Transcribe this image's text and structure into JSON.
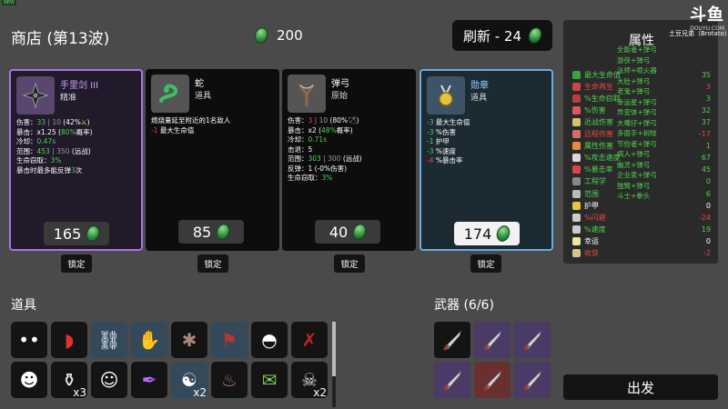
{
  "corner_tag": "NEW",
  "shop": {
    "title": "商店 (第13波)",
    "money": "200",
    "refresh_label": "刷新 - 24"
  },
  "cards": [
    {
      "name": "手里剑 III",
      "sub": "精准",
      "stats": [
        [
          {
            "t": "伤害：",
            "c": ""
          },
          {
            "t": "33",
            "c": "g"
          },
          {
            "t": " | 10 ",
            "c": "gy"
          },
          {
            "t": "(42%",
            "c": ""
          },
          {
            "t": "⚔",
            "c": "y"
          },
          {
            "t": ")",
            "c": ""
          }
        ],
        [
          {
            "t": "暴击：",
            "c": ""
          },
          {
            "t": "x1.25",
            "c": ""
          },
          {
            "t": " (",
            "c": ""
          },
          {
            "t": "80%",
            "c": "g"
          },
          {
            "t": "概率)",
            "c": ""
          }
        ],
        [
          {
            "t": "冷却：",
            "c": ""
          },
          {
            "t": "0.47s",
            "c": "g"
          }
        ],
        [
          {
            "t": "范围：",
            "c": ""
          },
          {
            "t": "453",
            "c": "g"
          },
          {
            "t": " | 350 ",
            "c": "gy"
          },
          {
            "t": "(远战)",
            "c": ""
          }
        ],
        [
          {
            "t": "生命窃取：",
            "c": ""
          },
          {
            "t": "3%",
            "c": "g"
          }
        ],
        [
          {
            "t": "暴击时最多能反弹",
            "c": ""
          },
          {
            "t": "3",
            "c": "g"
          },
          {
            "t": "次",
            "c": ""
          }
        ]
      ],
      "price": "165",
      "lock": "锁定"
    },
    {
      "name": "蛇",
      "sub": "道具",
      "stats": [
        [
          {
            "t": "燃烧量延至附近的1名敌人",
            "c": ""
          }
        ],
        [
          {
            "t": "-1",
            "c": "r"
          },
          {
            "t": " 最大生命值",
            "c": ""
          }
        ]
      ],
      "price": "85",
      "lock": "锁定"
    },
    {
      "name": "弹弓",
      "sub": "原始",
      "stats": [
        [
          {
            "t": "伤害：",
            "c": ""
          },
          {
            "t": "3",
            "c": "r"
          },
          {
            "t": " | 10 ",
            "c": "gy"
          },
          {
            "t": "(80%",
            "c": ""
          },
          {
            "t": "🏹",
            "c": "y"
          },
          {
            "t": ")",
            "c": ""
          }
        ],
        [
          {
            "t": "暴击：",
            "c": ""
          },
          {
            "t": "x2",
            "c": ""
          },
          {
            "t": " (",
            "c": ""
          },
          {
            "t": "48%",
            "c": "g"
          },
          {
            "t": "概率)",
            "c": ""
          }
        ],
        [
          {
            "t": "冷却：",
            "c": ""
          },
          {
            "t": "0.71s",
            "c": "g"
          }
        ],
        [
          {
            "t": "击退：",
            "c": ""
          },
          {
            "t": "5",
            "c": ""
          }
        ],
        [
          {
            "t": "范围：",
            "c": ""
          },
          {
            "t": "303",
            "c": "g"
          },
          {
            "t": " | 300 ",
            "c": "gy"
          },
          {
            "t": "(远战)",
            "c": ""
          }
        ],
        [
          {
            "t": "反弹：",
            "c": ""
          },
          {
            "t": "1 (-0%伤害)",
            "c": ""
          }
        ],
        [
          {
            "t": "生命窃取：",
            "c": ""
          },
          {
            "t": "3%",
            "c": "g"
          }
        ]
      ],
      "price": "40",
      "lock": "锁定"
    },
    {
      "name": "勋章",
      "sub": "道具",
      "stats": [
        [
          {
            "t": "-3",
            "c": "g"
          },
          {
            "t": " 最大生命值",
            "c": ""
          }
        ],
        [
          {
            "t": "-3",
            "c": "g"
          },
          {
            "t": " %伤害",
            "c": ""
          }
        ],
        [
          {
            "t": "-1",
            "c": "g"
          },
          {
            "t": " 护甲",
            "c": ""
          }
        ],
        [
          {
            "t": "-3",
            "c": "g"
          },
          {
            "t": " %速度",
            "c": ""
          }
        ],
        [
          {
            "t": "-4",
            "c": "r"
          },
          {
            "t": " %暴击率",
            "c": ""
          }
        ]
      ],
      "price": "174",
      "lock": "锁定"
    }
  ],
  "attributes": {
    "title": "属性",
    "rows": [
      {
        "label": "最大生命值",
        "value": "35",
        "color": "#4fd14f",
        "icon": "heart-icon",
        "ic": "#3ca43c"
      },
      {
        "label": "生命再生",
        "value": "3",
        "color": "#e84545",
        "icon": "regen-icon",
        "ic": "#d04545"
      },
      {
        "label": "%生命窃取",
        "value": "3",
        "color": "#4fd14f",
        "icon": "drop-icon",
        "ic": "#c03c3c"
      },
      {
        "label": "%伤害",
        "value": "32",
        "color": "#4fd14f",
        "icon": "damage-icon",
        "ic": "#d85a5a"
      },
      {
        "label": "近战伤害",
        "value": "37",
        "color": "#4fd14f",
        "icon": "sword-icon",
        "ic": "#d8c46a"
      },
      {
        "label": "远程伤害",
        "value": "-17",
        "color": "#e84545",
        "icon": "bow-icon",
        "ic": "#d86a6a"
      },
      {
        "label": "属性伤害",
        "value": "1",
        "color": "#4fd14f",
        "icon": "fire-icon",
        "ic": "#e88a3a"
      },
      {
        "label": "%攻击速度",
        "value": "67",
        "color": "#4fd14f",
        "icon": "hourglass-icon",
        "ic": "#d8d8d8"
      },
      {
        "label": "%暴击率",
        "value": "45",
        "color": "#4fd14f",
        "icon": "crit-icon",
        "ic": "#d84545"
      },
      {
        "label": "工程学",
        "value": "0",
        "color": "#4fd14f",
        "icon": "wrench-icon",
        "ic": "#888"
      },
      {
        "label": "范围",
        "value": "6",
        "color": "#4fd14f",
        "icon": "range-icon",
        "ic": "#bbb"
      },
      {
        "label": "护甲",
        "value": "0",
        "color": "#ffffff",
        "icon": "shield-icon",
        "ic": "#e8c43a"
      },
      {
        "label": "%闪避",
        "value": "-24",
        "color": "#e84545",
        "icon": "dodge-icon",
        "ic": "#ccc"
      },
      {
        "label": "%速度",
        "value": "19",
        "color": "#4fd14f",
        "icon": "speed-icon",
        "ic": "#ccc"
      },
      {
        "label": "幸运",
        "value": "0",
        "color": "#ffffff",
        "icon": "luck-icon",
        "ic": "#e8e8a0"
      },
      {
        "label": "收获",
        "value": "-2",
        "color": "#e84545",
        "icon": "harvest-icon",
        "ic": "#d8c48a"
      }
    ],
    "overlay_lines": [
      "全能者+弹弓",
      "游侠+弹弓",
      "法师+喷火器",
      "大肚+弹弓",
      "老鬼+弹弓",
      "幸运星+弹弓",
      "异变体+弹弓",
      "大嘴仔+弹弓",
      "多面手+树枝",
      "节俭者+弹弓",
      "病人+弹弓",
      "幽灵+弹弓",
      "企业家+弹弓",
      "独臂+弹弓",
      "斗士+拳头"
    ]
  },
  "logo": {
    "big": "斗鱼",
    "small": "DOUYU.COM",
    "tag": "土豆兄弟（Brotato）"
  },
  "items": {
    "title": "道具",
    "list": [
      {
        "name": "eyes-item-icon",
        "count": "",
        "bg": ""
      },
      {
        "name": "red-blade-item-icon",
        "count": "",
        "bg": ""
      },
      {
        "name": "chain-item-icon",
        "count": "",
        "bg": "blue"
      },
      {
        "name": "claw-item-icon",
        "count": "",
        "bg": "blue"
      },
      {
        "name": "hedgehog-item-icon",
        "count": "",
        "bg": ""
      },
      {
        "name": "banner-item-icon",
        "count": "",
        "bg": "blue"
      },
      {
        "name": "helmet-item-icon",
        "count": "",
        "bg": ""
      },
      {
        "name": "red-branch-item-icon",
        "count": "",
        "bg": ""
      },
      {
        "name": "ghost-item-icon",
        "count": "",
        "bg": ""
      },
      {
        "name": "potion-item-icon",
        "count": "x3",
        "bg": ""
      },
      {
        "name": "face-item-icon",
        "count": "",
        "bg": ""
      },
      {
        "name": "syringe-item-icon",
        "count": "",
        "bg": ""
      },
      {
        "name": "ninja-item-icon",
        "count": "x2",
        "bg": "blue"
      },
      {
        "name": "poop-item-icon",
        "count": "",
        "bg": ""
      },
      {
        "name": "cash-item-icon",
        "count": "",
        "bg": ""
      },
      {
        "name": "skull-item-icon",
        "count": "x2",
        "bg": ""
      }
    ]
  },
  "weapons": {
    "title": "武器 (6/6)",
    "list": [
      {
        "name": "knife-weapon-icon",
        "bg": "#141414"
      },
      {
        "name": "knife-weapon-icon",
        "bg": "#4a3a66"
      },
      {
        "name": "knife-weapon-icon",
        "bg": "#4a3a66"
      },
      {
        "name": "knife-weapon-icon",
        "bg": "#4a3a66"
      },
      {
        "name": "knife-weapon-icon",
        "bg": "#6a3030"
      },
      {
        "name": "knife-weapon-icon",
        "bg": "#4a3a66"
      }
    ]
  },
  "go_label": "出发"
}
